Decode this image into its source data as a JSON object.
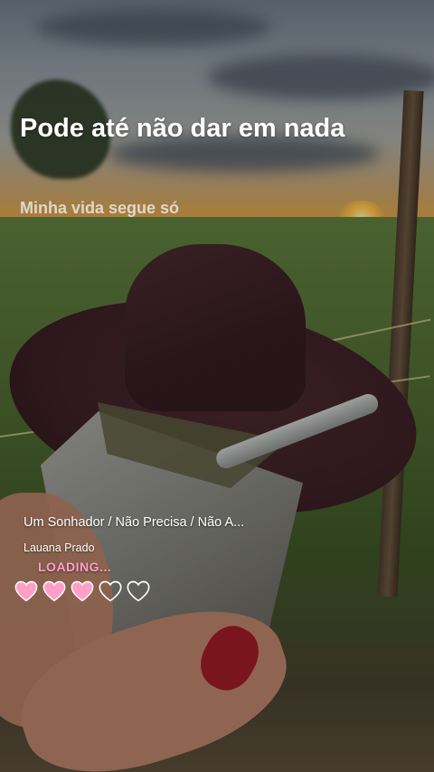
{
  "story": {
    "title": "Pode até não dar em nada",
    "subtitle": "Minha vida segue só"
  },
  "music": {
    "song": "Um Sonhador / Não Precisa / Não A...",
    "artist": "Lauana Prado",
    "status": "LOADING..."
  },
  "progress": {
    "filled": 3,
    "total": 5,
    "filled_color": "#ff9fc8",
    "empty_color": "#ffffff"
  }
}
